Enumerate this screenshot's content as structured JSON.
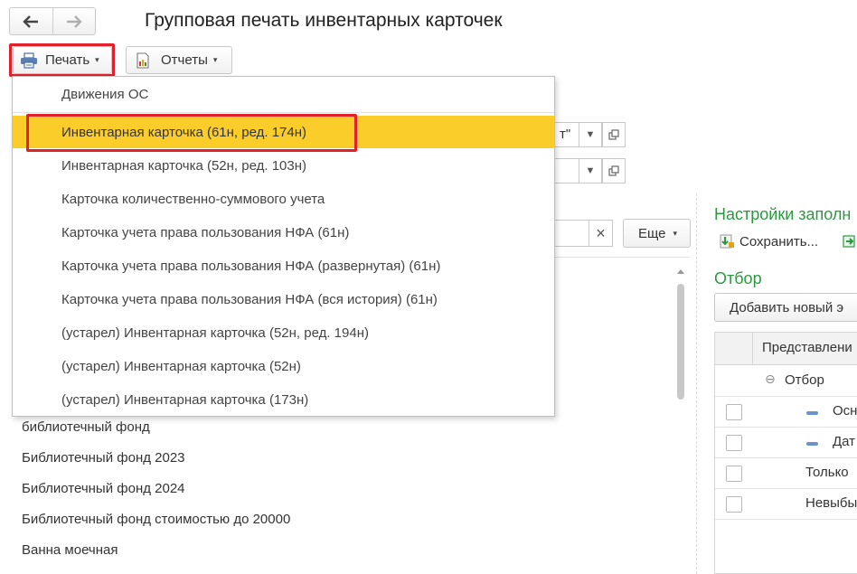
{
  "window": {
    "title": "Групповая печать инвентарных карточек"
  },
  "nav": {
    "back_icon": "arrow-left-icon",
    "forward_icon": "arrow-right-icon"
  },
  "toolbar": {
    "print_label": "Печать",
    "reports_label": "Отчеты",
    "caret": "▾"
  },
  "print_menu": {
    "items": [
      "Движения ОС",
      "Инвентарная карточка (61н, ред. 174н)",
      "Инвентарная карточка (52н, ред. 103н)",
      "Карточка количественно-суммового учета",
      "Карточка учета права пользования НФА (61н)",
      "Карточка учета права пользования НФА (развернутая) (61н)",
      "Карточка учета права пользования НФА (вся история) (61н)",
      "(устарел) Инвентарная карточка (52н, ред. 194н)",
      "(устарел) Инвентарная карточка (52н)",
      "(устарел) Инвентарная карточка (173н)"
    ],
    "selected_index": 1
  },
  "filters": {
    "field1_tail": "т\"",
    "search_clear": "×",
    "more_label": "Еще"
  },
  "list": {
    "items": [
      "библиотечный фонд",
      "Библиотечный фонд 2023",
      "Библиотечный фонд 2024",
      "Библиотечный фонд стоимостью до 20000",
      "Ванна моечная"
    ]
  },
  "settings": {
    "title": "Настройки заполн",
    "save_label": "Сохранить...",
    "filter_title": "Отбор",
    "add_new_label": "Добавить новый э",
    "column_header": "Представлени",
    "rows": [
      {
        "label": "Отбор",
        "type": "group"
      },
      {
        "label": "Осн",
        "type": "item"
      },
      {
        "label": "Дат",
        "type": "item"
      },
      {
        "label": "Только",
        "type": "plain"
      },
      {
        "label": "Невыбы",
        "type": "plain"
      }
    ]
  },
  "colors": {
    "accent_green": "#2b9a3f",
    "highlight_red": "#e2202a",
    "selected_yellow": "#fbcd2a"
  }
}
